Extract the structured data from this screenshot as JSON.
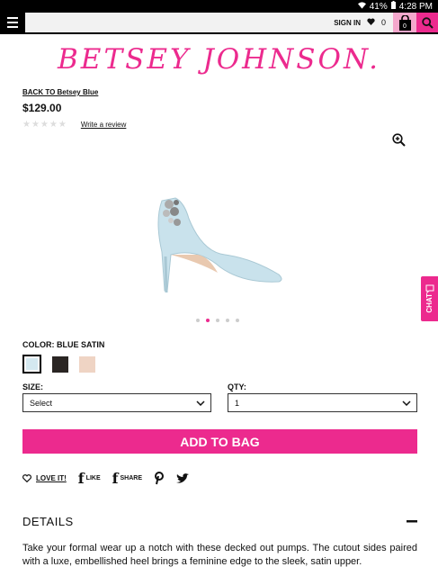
{
  "status_bar": {
    "battery": "41%",
    "time": "4:28 PM"
  },
  "header": {
    "sign_in": "SIGN IN",
    "wishlist_count": "0",
    "bag_count": "0"
  },
  "brand": {
    "logo_text": "BETSEY JOHNSON."
  },
  "product": {
    "back_link": "BACK TO Betsey Blue",
    "price": "$129.00",
    "review_link": "Write a review",
    "rating": 0
  },
  "gallery": {
    "slide_count": 5,
    "active_index": 1
  },
  "chat": {
    "label": "CHAT"
  },
  "color": {
    "label": "COLOR:",
    "selected": "BLUE SATIN",
    "swatches": [
      "#d4e8f0",
      "#2a2523",
      "#efd4c4"
    ]
  },
  "size": {
    "label": "SIZE:",
    "value": "Select"
  },
  "qty": {
    "label": "QTY:",
    "value": "1"
  },
  "add_to_bag": "ADD TO BAG",
  "social": {
    "love": "LOVE IT!",
    "like": "LIKE",
    "share": "SHARE"
  },
  "details": {
    "heading": "DETAILS",
    "description": "Take your formal wear up a notch with these decked out pumps. The cutout sides paired with a luxe, embellished heel brings a feminine edge to the sleek, satin upper."
  },
  "colors": {
    "accent": "#ec2a8e",
    "accent_light": "#f4a7cc"
  }
}
